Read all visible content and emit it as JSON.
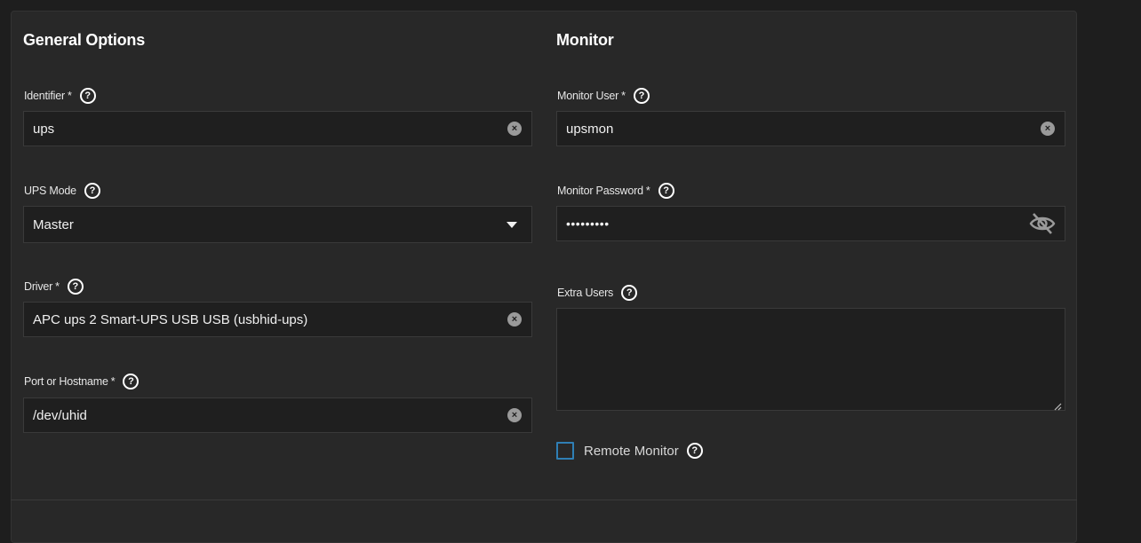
{
  "general": {
    "title": "General Options",
    "identifier": {
      "label": "Identifier",
      "required": "*",
      "value": "ups"
    },
    "ups_mode": {
      "label": "UPS Mode",
      "value": "Master"
    },
    "driver": {
      "label": "Driver",
      "required": "*",
      "value": "APC ups 2 Smart-UPS USB USB (usbhid-ups)"
    },
    "port": {
      "label": "Port or Hostname",
      "required": "*",
      "value": "/dev/uhid"
    }
  },
  "monitor": {
    "title": "Monitor",
    "user": {
      "label": "Monitor User",
      "required": "*",
      "value": "upsmon"
    },
    "password": {
      "label": "Monitor Password",
      "required": "*",
      "value": "•••••••••"
    },
    "extra_users": {
      "label": "Extra Users",
      "value": ""
    },
    "remote_monitor": {
      "label": "Remote Monitor",
      "checked": false
    }
  },
  "icons": {
    "help": "?",
    "clear": "×"
  },
  "colors": {
    "background": "#1e1e1e",
    "card": "#282828",
    "input": "#1f1f1f",
    "border": "#3a3a3a",
    "checkbox_accent": "#2f7fb5"
  }
}
